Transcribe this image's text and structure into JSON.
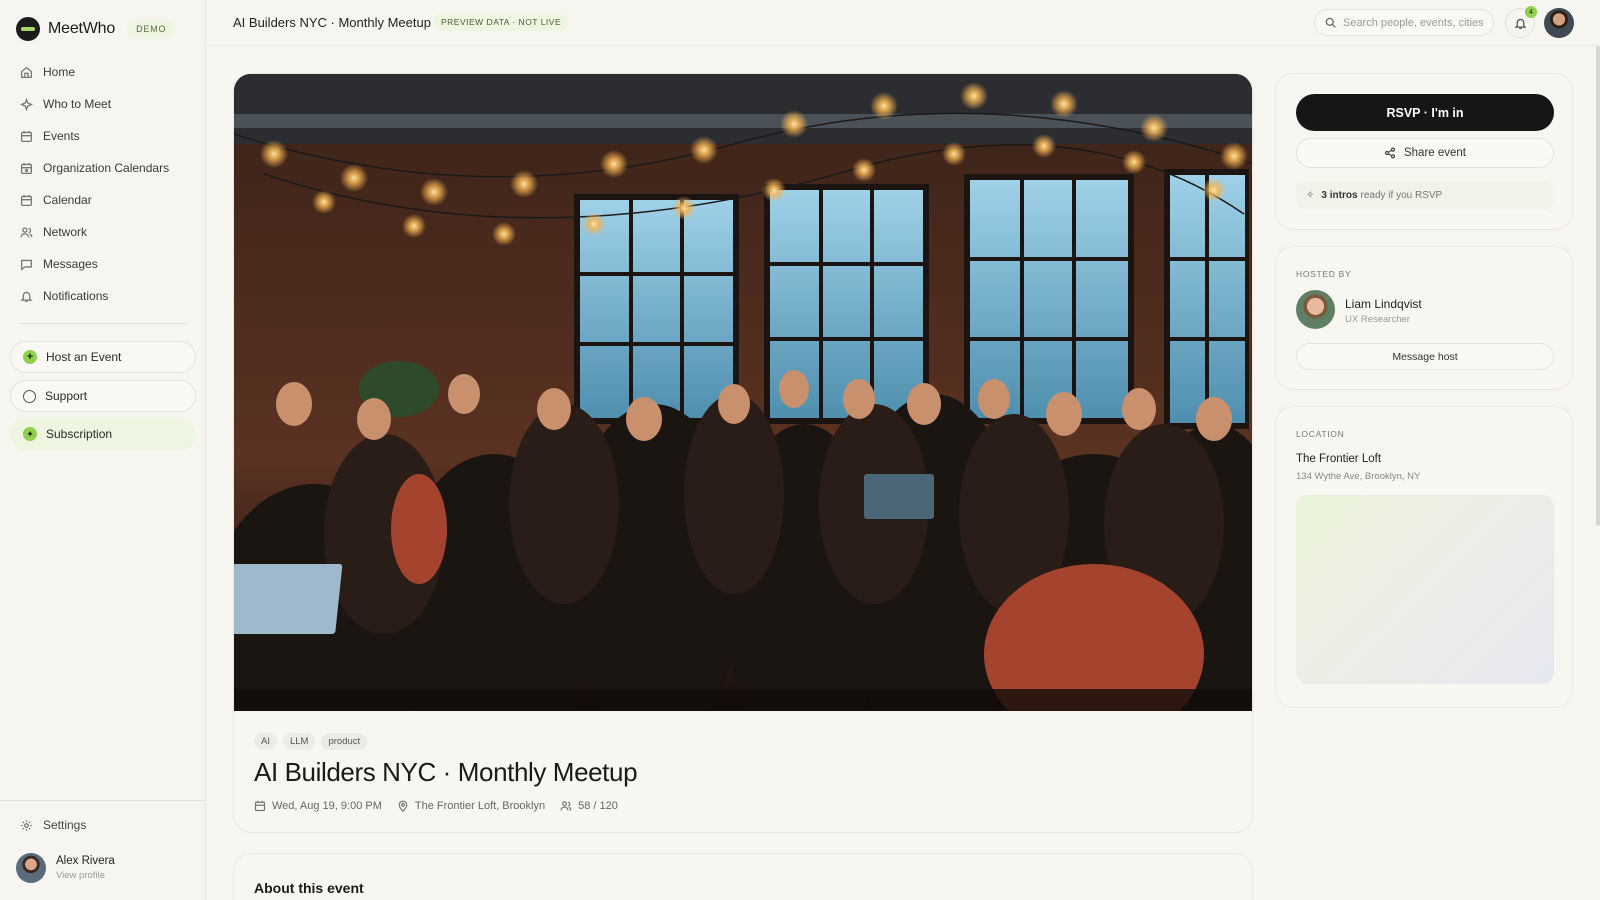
{
  "brand": {
    "name": "MeetWho",
    "badge": "DEMO"
  },
  "sidebar": {
    "items": [
      {
        "label": "Home",
        "icon": "home-icon"
      },
      {
        "label": "Who to Meet",
        "icon": "sparkles-icon"
      },
      {
        "label": "Events",
        "icon": "calendar-icon"
      },
      {
        "label": "Organization Calendars",
        "icon": "calendar-org-icon"
      },
      {
        "label": "Calendar",
        "icon": "calendar-icon"
      },
      {
        "label": "Network",
        "icon": "users-icon"
      },
      {
        "label": "Messages",
        "icon": "message-icon"
      },
      {
        "label": "Notifications",
        "icon": "bell-icon"
      }
    ],
    "host_event": "Host an Event",
    "support": "Support",
    "subscription": "Subscription",
    "settings": "Settings",
    "user": {
      "name": "Alex Rivera",
      "sub": "View profile"
    }
  },
  "header": {
    "title": "AI Builders NYC · Monthly Meetup",
    "preview_badge": "PREVIEW DATA · NOT LIVE",
    "search_placeholder": "Search people, events, cities...",
    "notification_count": "4"
  },
  "event": {
    "tags": [
      "AI",
      "LLM",
      "product"
    ],
    "title": "AI Builders NYC · Monthly Meetup",
    "date": "Wed, Aug 19, 9:00 PM",
    "venue_short": "The Frontier Loft, Brooklyn",
    "attendance": "58 / 120",
    "about_heading": "About this event"
  },
  "actions": {
    "rsvp": "RSVP · I'm in",
    "share": "Share event",
    "intros_bold": "3 intros",
    "intros_rest": "ready if you RSVP"
  },
  "host": {
    "section": "HOSTED BY",
    "name": "Liam Lindqvist",
    "role": "UX Researcher",
    "message_button": "Message host"
  },
  "location": {
    "section": "LOCATION",
    "name": "The Frontier Loft",
    "address": "134 Wythe Ave, Brooklyn, NY"
  },
  "colors": {
    "accent": "#8fd14f",
    "primary": "#161616",
    "background": "#f7f5f0"
  }
}
